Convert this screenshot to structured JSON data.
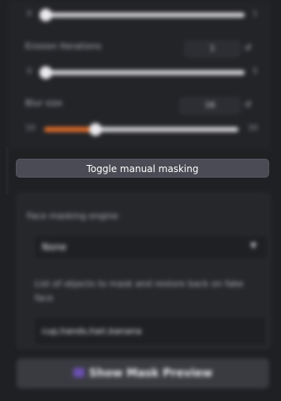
{
  "sliders": [
    {
      "label": "",
      "min": "0",
      "max": "1",
      "value_fraction": 0.0
    },
    {
      "label": "Erosion Iterations",
      "min": "0",
      "max": "5",
      "value": "1",
      "value_fraction": 0.0
    },
    {
      "label": "Blur size",
      "min": "10",
      "max": "30",
      "value": "16",
      "value_fraction": 0.27
    }
  ],
  "toggle_manual_masking": "Toggle manual masking",
  "face_masking_engine": {
    "label": "Face masking engine",
    "selected": "None"
  },
  "objects_to_mask": {
    "label": "List of objects to mask and restore back on fake face",
    "value": "cup,hands,hair,banana"
  },
  "show_mask_preview": "Show Mask Preview",
  "colors": {
    "accent": "#e8702a",
    "button_bg": "#4b4b55",
    "panel_bg": "#26272b"
  }
}
